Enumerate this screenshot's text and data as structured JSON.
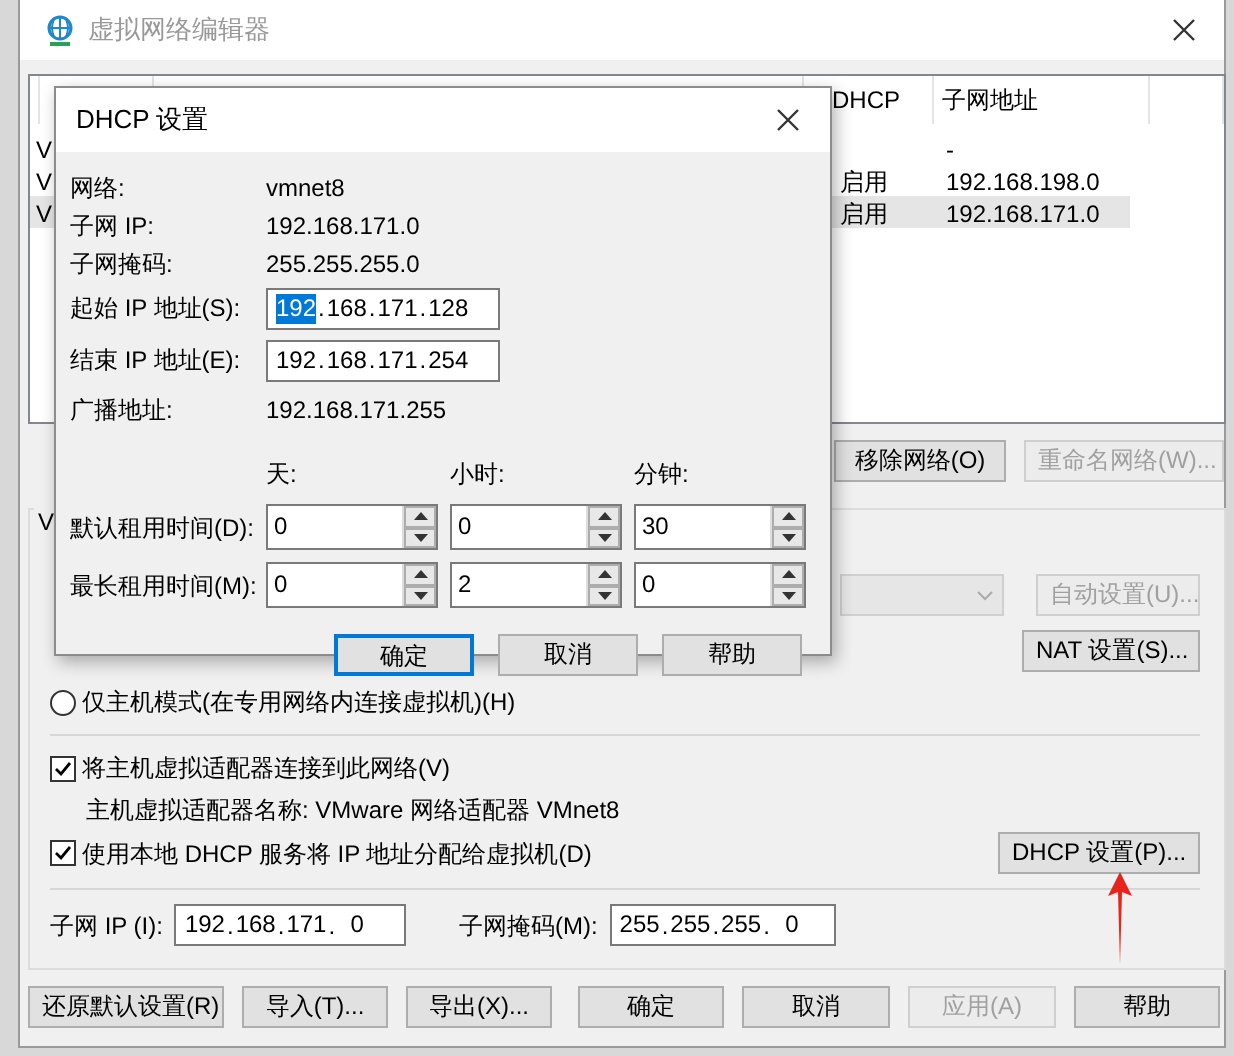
{
  "window": {
    "title": "虚拟网络编辑器"
  },
  "network_table": {
    "columns": [
      {
        "label": "DHCP"
      },
      {
        "label": "子网地址"
      }
    ],
    "rows": [
      {
        "name": "V",
        "subnet": "-",
        "selected": false
      },
      {
        "name": "V",
        "dhcp": "启用",
        "subnet": "192.168.198.0",
        "selected": false
      },
      {
        "name": "V",
        "dhcp": "启用",
        "subnet": "192.168.171.0",
        "selected": true
      }
    ]
  },
  "table_buttons": [
    {
      "label": "移除网络(O)",
      "disabled": false
    },
    {
      "label": "重命名网络(W)...",
      "disabled": true
    }
  ],
  "settings_group": {
    "label": "V",
    "auto_button": {
      "label": "自动设置(U)...",
      "disabled": true
    },
    "nat_button": {
      "label": "NAT 设置(S)...",
      "disabled": false
    },
    "modes": [
      {
        "label": "仅主机模式(在专用网络内连接虚拟机)(H)",
        "selected": false
      }
    ],
    "connect_adapter": {
      "label": "将主机虚拟适配器连接到此网络(V)",
      "checked": true
    },
    "adapter_name": "主机虚拟适配器名称: VMware 网络适配器 VMnet8",
    "use_dhcp": {
      "label": "使用本地 DHCP 服务将 IP 地址分配给虚拟机(D)",
      "checked": true
    },
    "dhcp_button": {
      "label": "DHCP 设置(P)...",
      "disabled": false
    },
    "subnet_ip": {
      "label": "子网 IP (I):",
      "separator": ".",
      "octets": [
        {
          "text": "192",
          "selected": false
        },
        {
          "text": "168",
          "selected": false
        },
        {
          "text": "171",
          "selected": false
        },
        {
          "text": "0",
          "selected": false
        }
      ]
    },
    "subnet_mask": {
      "label": "子网掩码(M):",
      "separator": ".",
      "octets": [
        {
          "text": "255",
          "selected": false
        },
        {
          "text": "255",
          "selected": false
        },
        {
          "text": "255",
          "selected": false
        },
        {
          "text": "0",
          "selected": false
        }
      ]
    }
  },
  "footer_buttons": [
    {
      "label": "还原默认设置(R)",
      "disabled": false
    },
    {
      "label": "导入(T)...",
      "disabled": false
    },
    {
      "label": "导出(X)...",
      "disabled": false
    },
    {
      "label": "确定",
      "disabled": false
    },
    {
      "label": "取消",
      "disabled": false
    },
    {
      "label": "应用(A)",
      "disabled": true
    },
    {
      "label": "帮助",
      "disabled": false
    }
  ],
  "dialog": {
    "title": "DHCP 设置",
    "info": [
      {
        "label": "网络:",
        "value": "vmnet8"
      },
      {
        "label": "子网 IP:",
        "value": "192.168.171.0"
      },
      {
        "label": "子网掩码:",
        "value": "255.255.255.0"
      }
    ],
    "start_ip": {
      "label": "起始 IP 地址(S):",
      "separator": ".",
      "octets": [
        {
          "text": "192",
          "selected": true
        },
        {
          "text": "168",
          "selected": false
        },
        {
          "text": "171",
          "selected": false
        },
        {
          "text": "128",
          "selected": false
        }
      ]
    },
    "end_ip": {
      "label": "结束 IP 地址(E):",
      "separator": ".",
      "octets": [
        {
          "text": "192",
          "selected": false
        },
        {
          "text": "168",
          "selected": false
        },
        {
          "text": "171",
          "selected": false
        },
        {
          "text": "254",
          "selected": false
        }
      ]
    },
    "broadcast": {
      "label": "广播地址:",
      "value": "192.168.171.255"
    },
    "lease_columns": [
      "天:",
      "小时:",
      "分钟:"
    ],
    "lease_rows": [
      {
        "label": "默认租用时间(D):",
        "values": [
          "0",
          "0",
          "30"
        ]
      },
      {
        "label": "最长租用时间(M):",
        "values": [
          "0",
          "2",
          "0"
        ]
      }
    ],
    "buttons": [
      {
        "label": "确定",
        "default": true
      },
      {
        "label": "取消",
        "default": false
      },
      {
        "label": "帮助",
        "default": false
      }
    ]
  }
}
